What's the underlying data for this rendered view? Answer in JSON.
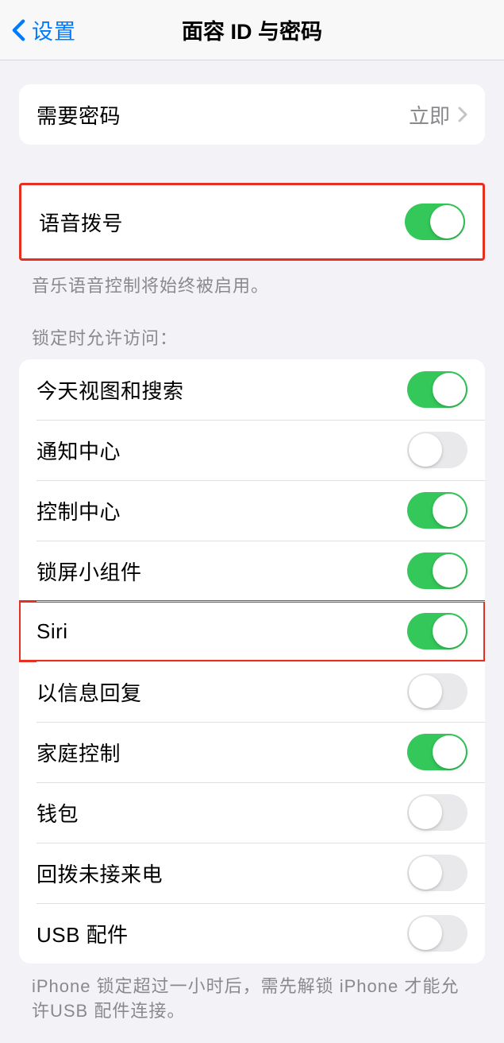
{
  "navbar": {
    "back_label": "设置",
    "title": "面容 ID 与密码"
  },
  "require_passcode": {
    "label": "需要密码",
    "value": "立即"
  },
  "voice_dial": {
    "label": "语音拨号",
    "enabled": true,
    "footer": "音乐语音控制将始终被启用。"
  },
  "lock_access": {
    "header": "锁定时允许访问：",
    "items": [
      {
        "label": "今天视图和搜索",
        "enabled": true
      },
      {
        "label": "通知中心",
        "enabled": false
      },
      {
        "label": "控制中心",
        "enabled": true
      },
      {
        "label": "锁屏小组件",
        "enabled": true
      },
      {
        "label": "Siri",
        "enabled": true,
        "highlighted": true
      },
      {
        "label": "以信息回复",
        "enabled": false
      },
      {
        "label": "家庭控制",
        "enabled": true
      },
      {
        "label": "钱包",
        "enabled": false
      },
      {
        "label": "回拨未接来电",
        "enabled": false
      },
      {
        "label": "USB 配件",
        "enabled": false
      }
    ],
    "footer": "iPhone 锁定超过一小时后，需先解锁 iPhone 才能允许USB 配件连接。"
  }
}
